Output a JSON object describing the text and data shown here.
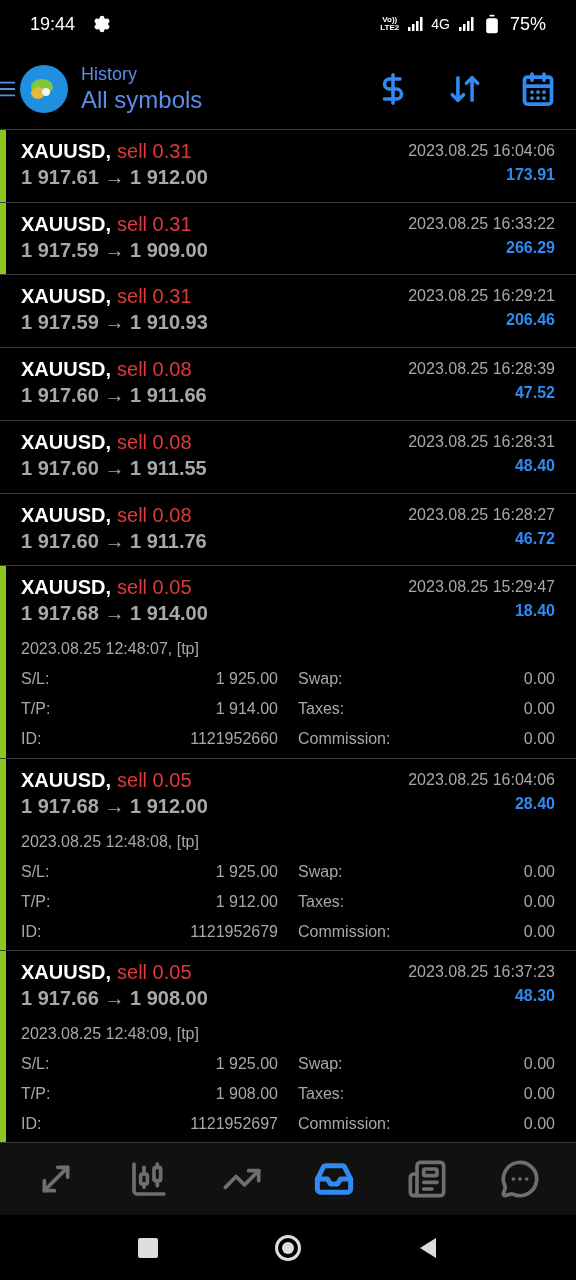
{
  "status_bar": {
    "time": "19:44",
    "volte_top": "Vo))",
    "volte_bottom": "LTE2",
    "network": "4G",
    "battery": "75%"
  },
  "header": {
    "title": "History",
    "subtitle": "All symbols"
  },
  "deals": [
    {
      "symbol": "XAUUSD,",
      "side": "sell 0.31",
      "prices": "1 917.61 → 1 912.00",
      "time": "2023.08.25 16:04:06",
      "profit": "173.91",
      "highlighted": true
    },
    {
      "symbol": "XAUUSD,",
      "side": "sell 0.31",
      "prices": "1 917.59 → 1 909.00",
      "time": "2023.08.25 16:33:22",
      "profit": "266.29",
      "highlighted": true
    },
    {
      "symbol": "XAUUSD,",
      "side": "sell 0.31",
      "prices": "1 917.59 → 1 910.93",
      "time": "2023.08.25 16:29:21",
      "profit": "206.46",
      "highlighted": false
    },
    {
      "symbol": "XAUUSD,",
      "side": "sell 0.08",
      "prices": "1 917.60 → 1 911.66",
      "time": "2023.08.25 16:28:39",
      "profit": "47.52",
      "highlighted": false
    },
    {
      "symbol": "XAUUSD,",
      "side": "sell 0.08",
      "prices": "1 917.60 → 1 911.55",
      "time": "2023.08.25 16:28:31",
      "profit": "48.40",
      "highlighted": false
    },
    {
      "symbol": "XAUUSD,",
      "side": "sell 0.08",
      "prices": "1 917.60 → 1 911.76",
      "time": "2023.08.25 16:28:27",
      "profit": "46.72",
      "highlighted": false
    },
    {
      "symbol": "XAUUSD,",
      "side": "sell 0.05",
      "prices": "1 917.68 → 1 914.00",
      "time": "2023.08.25 15:29:47",
      "profit": "18.40",
      "highlighted": true,
      "details": {
        "open_time": "2023.08.25 12:48:07, [tp]",
        "fields": [
          {
            "label": "S/L:",
            "value": "1 925.00"
          },
          {
            "label": "Swap:",
            "value": "0.00"
          },
          {
            "label": "T/P:",
            "value": "1 914.00"
          },
          {
            "label": "Taxes:",
            "value": "0.00"
          },
          {
            "label": "ID:",
            "value": "1121952660"
          },
          {
            "label": "Commission:",
            "value": "0.00"
          }
        ]
      }
    },
    {
      "symbol": "XAUUSD,",
      "side": "sell 0.05",
      "prices": "1 917.68 → 1 912.00",
      "time": "2023.08.25 16:04:06",
      "profit": "28.40",
      "highlighted": true,
      "details": {
        "open_time": "2023.08.25 12:48:08, [tp]",
        "fields": [
          {
            "label": "S/L:",
            "value": "1 925.00"
          },
          {
            "label": "Swap:",
            "value": "0.00"
          },
          {
            "label": "T/P:",
            "value": "1 912.00"
          },
          {
            "label": "Taxes:",
            "value": "0.00"
          },
          {
            "label": "ID:",
            "value": "1121952679"
          },
          {
            "label": "Commission:",
            "value": "0.00"
          }
        ]
      }
    },
    {
      "symbol": "XAUUSD,",
      "side": "sell 0.05",
      "prices": "1 917.66 → 1 908.00",
      "time": "2023.08.25 16:37:23",
      "profit": "48.30",
      "highlighted": true,
      "details": {
        "open_time": "2023.08.25 12:48:09, [tp]",
        "fields": [
          {
            "label": "S/L:",
            "value": "1 925.00"
          },
          {
            "label": "Swap:",
            "value": "0.00"
          },
          {
            "label": "T/P:",
            "value": "1 908.00"
          },
          {
            "label": "Taxes:",
            "value": "0.00"
          },
          {
            "label": "ID:",
            "value": "1121952697"
          },
          {
            "label": "Commission:",
            "value": "0.00"
          }
        ]
      }
    }
  ],
  "bottom_nav": [
    {
      "kind": "quotes",
      "selected": false
    },
    {
      "kind": "chart",
      "selected": false
    },
    {
      "kind": "trade",
      "selected": false
    },
    {
      "kind": "history",
      "selected": true
    },
    {
      "kind": "news",
      "selected": false
    },
    {
      "kind": "chat",
      "selected": false
    }
  ]
}
